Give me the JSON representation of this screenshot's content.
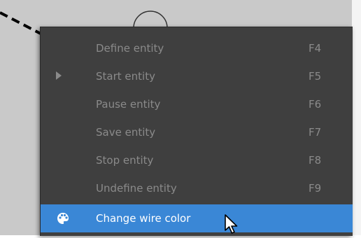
{
  "context_menu": {
    "items": [
      {
        "label": "Define entity",
        "shortcut": "F4",
        "enabled": false
      },
      {
        "label": "Start entity",
        "shortcut": "F5",
        "enabled": false,
        "submenu_arrow": true
      },
      {
        "label": "Pause entity",
        "shortcut": "F6",
        "enabled": false
      },
      {
        "label": "Save entity",
        "shortcut": "F7",
        "enabled": false
      },
      {
        "label": "Stop entity",
        "shortcut": "F8",
        "enabled": false
      },
      {
        "label": "Undefine entity",
        "shortcut": "F9",
        "enabled": false
      },
      {
        "label": "Change wire color",
        "shortcut": "",
        "enabled": true,
        "highlighted": true,
        "icon": "palette-icon"
      }
    ]
  },
  "colors": {
    "menu_background": "#3f3f3f",
    "highlight": "#3a87d6",
    "disabled_text": "#8a8a8a",
    "active_text": "#ffffff"
  }
}
